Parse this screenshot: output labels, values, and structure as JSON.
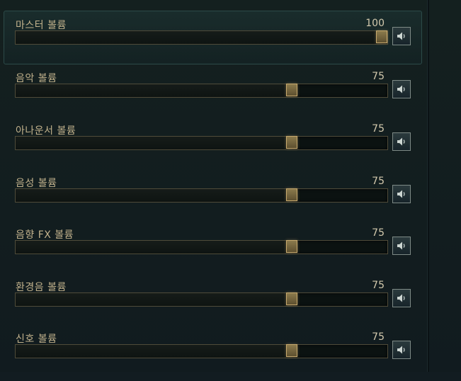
{
  "volume_settings": [
    {
      "label": "마스터 볼륨",
      "value": "100",
      "level": 1.0,
      "highlighted": true
    },
    {
      "label": "음악 볼륨",
      "value": "75",
      "level": 0.75,
      "highlighted": false
    },
    {
      "label": "아나운서 볼륨",
      "value": "75",
      "level": 0.75,
      "highlighted": false
    },
    {
      "label": "음성 볼륨",
      "value": "75",
      "level": 0.75,
      "highlighted": false
    },
    {
      "label": "음향 FX 볼륨",
      "value": "75",
      "level": 0.75,
      "highlighted": false
    },
    {
      "label": "환경음 볼륨",
      "value": "75",
      "level": 0.75,
      "highlighted": false
    },
    {
      "label": "신호 볼륨",
      "value": "75",
      "level": 0.75,
      "highlighted": false
    }
  ],
  "colors": {
    "background": "#121c21",
    "label_gold": "#c2b28c",
    "thumb_gold": "#c8aa6e",
    "track_border": "#4f4b39",
    "highlight_border": "#2c4a48"
  },
  "icons": {
    "mute_button": "speaker-icon"
  }
}
